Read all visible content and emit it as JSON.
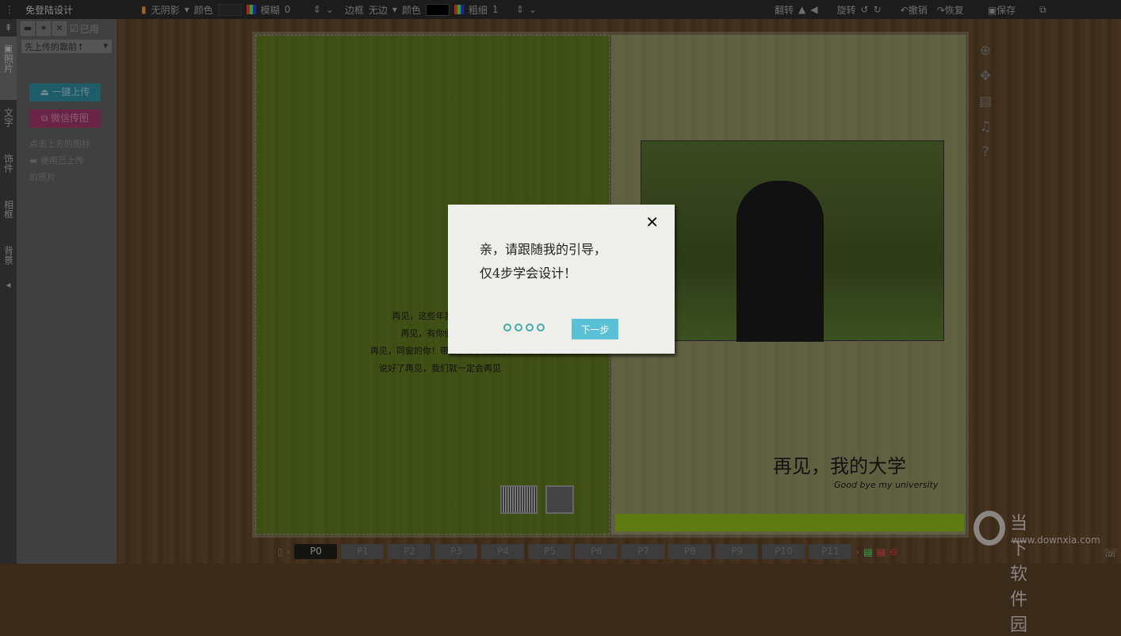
{
  "topbar": {
    "title": "免登陆设计",
    "shadow": "无阴影",
    "color_label": "颜色",
    "blur_label": "模糊",
    "blur_value": "0",
    "border_label": "边框",
    "border_value": "无边",
    "border_color_label": "颜色",
    "thickness_label": "粗细",
    "thickness_value": "1",
    "flip_label": "翻转",
    "rotate_label": "旋转",
    "undo_label": "撤销",
    "redo_label": "恢复",
    "save_label": "保存"
  },
  "left_tabs": [
    "照片",
    "文字",
    "饰件",
    "相框",
    "背景"
  ],
  "panel": {
    "used_label": "已用",
    "sort_select": "先上传的靠前↑",
    "upload_button": "一键上传",
    "wechat_button": "微信传图",
    "hint_line1": "点击上方的图标",
    "hint_line2": "使用已上传",
    "hint_line3": "的照片"
  },
  "canvas": {
    "poem": [
      "再见，这些年我们的时光",
      "再见，有你们的青春",
      "再见，同窗的你！带上梦想，去远航",
      "说好了再见，我们就一定会再见"
    ],
    "caption": "再见，我的大学",
    "caption_en": "Good bye my university"
  },
  "dialog": {
    "line1": "亲，请跟随我的引导，",
    "line2": "仅4步学会设计！",
    "next_button": "下一步",
    "steps": 4,
    "close": "✕"
  },
  "pages": {
    "items": [
      "P0",
      "P1",
      "P2",
      "P3",
      "P4",
      "P5",
      "P6",
      "P7",
      "P8",
      "P9",
      "P10",
      "P11"
    ],
    "active": "P0"
  },
  "watermark": {
    "name": "当下软件园",
    "url": "www.downxia.com"
  }
}
